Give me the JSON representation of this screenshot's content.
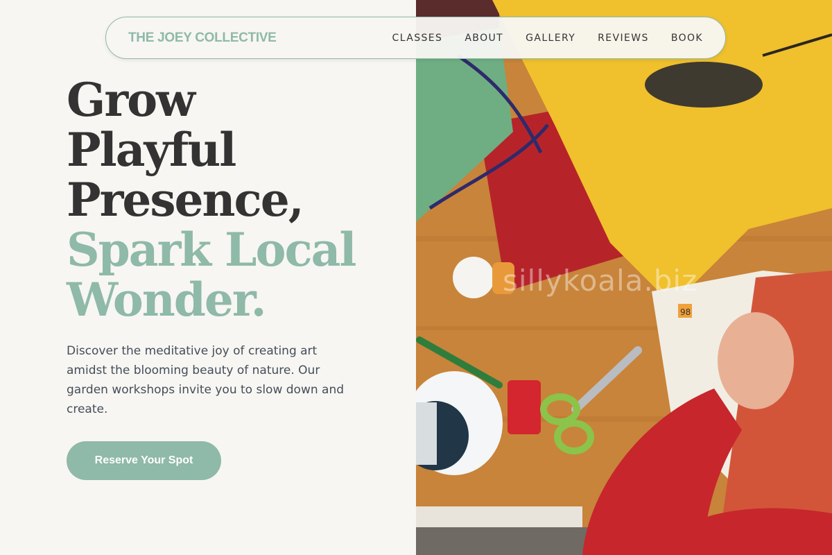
{
  "nav": {
    "brand": "THE JOEY COLLECTIVE",
    "links": [
      "CLASSES",
      "ABOUT",
      "GALLERY",
      "REVIEWS",
      "BOOK"
    ]
  },
  "hero": {
    "headline_lines": [
      "Grow",
      "Playful",
      "Presence,"
    ],
    "accent_lines": [
      "Spark Local",
      "Wonder."
    ],
    "description": "Discover the meditative joy of creating art amidst the blooming beauty of nature. Our garden workshops invite you to slow down and create.",
    "cta_label": "Reserve Your Spot"
  },
  "photo": {
    "watermark": "sillykoala.biz",
    "page_number": "98"
  },
  "colors": {
    "accent": "#8fb9a8",
    "text_dark": "#333333",
    "background": "#f7f6f2"
  }
}
